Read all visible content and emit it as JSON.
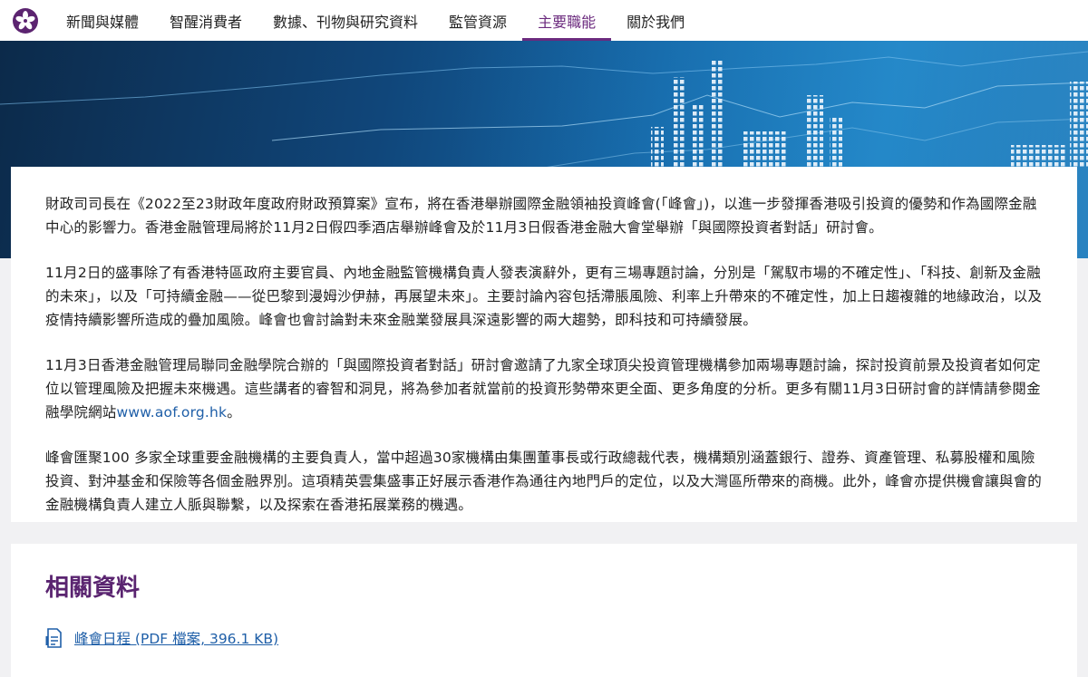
{
  "nav": {
    "items": [
      {
        "label": "新聞與媒體"
      },
      {
        "label": "智醒消費者"
      },
      {
        "label": "數據、刊物與研究資料"
      },
      {
        "label": "監管資源"
      },
      {
        "label": "主要職能",
        "active": true
      },
      {
        "label": "關於我們"
      }
    ],
    "accent": "#6b2a7e"
  },
  "article": {
    "p1": "財政司司長在《2022至23財政年度政府財政預算案》宣布，將在香港舉辦國際金融領袖投資峰會(「峰會」)，以進一步發揮香港吸引投資的優勢和作為國際金融中心的影響力。香港金融管理局將於11月2日假四季酒店舉辦峰會及於11月3日假香港金融大會堂舉辦「與國際投資者對話」研討會。",
    "p2": "11月2日的盛事除了有香港特區政府主要官員、內地金融監管機構負責人發表演辭外，更有三場專題討論，分別是「駕馭市場的不確定性」、「科技、創新及金融的未來」，以及「可持續金融——從巴黎到漫姆沙伊赫，再展望未來」。主要討論內容包括滯脹風險、利率上升帶來的不確定性，加上日趨複雜的地緣政治，以及疫情持續影響所造成的疊加風險。峰會也會討論對未來金融業發展具深遠影響的兩大趨勢，即科技和可持續發展。",
    "p3_text": "11月3日香港金融管理局聯同金融學院合辦的「與國際投資者對話」研討會邀請了九家全球頂尖投資管理機構參加兩場專題討論，探討投資前景及投資者如何定位以管理風險及把握未來機遇。這些講者的睿智和洞見，將為參加者就當前的投資形勢帶來更全面、更多角度的分析。更多有關11月3日研討會的詳情請參閱金融學院網站",
    "p3_link": "www.aof.org.hk",
    "p3_end": "。",
    "p4": "峰會匯聚100 多家全球重要金融機構的主要負責人，當中超過30家機構由集團董事長或行政總裁代表，機構類別涵蓋銀行、證券、資產管理、私募股權和風險投資、對沖基金和保險等各個金融界別。這項精英雲集盛事正好展示香港作為通往內地門戶的定位，以及大灣區所帶來的商機。此外，峰會亦提供機會讓與會的金融機構負責人建立人脈與聯繫，以及探索在香港拓展業務的機遇。"
  },
  "related": {
    "title": "相關資料",
    "items": [
      {
        "label": "峰會日程 (PDF 檔案, 396.1 KB)",
        "icon": "document-icon"
      }
    ]
  }
}
